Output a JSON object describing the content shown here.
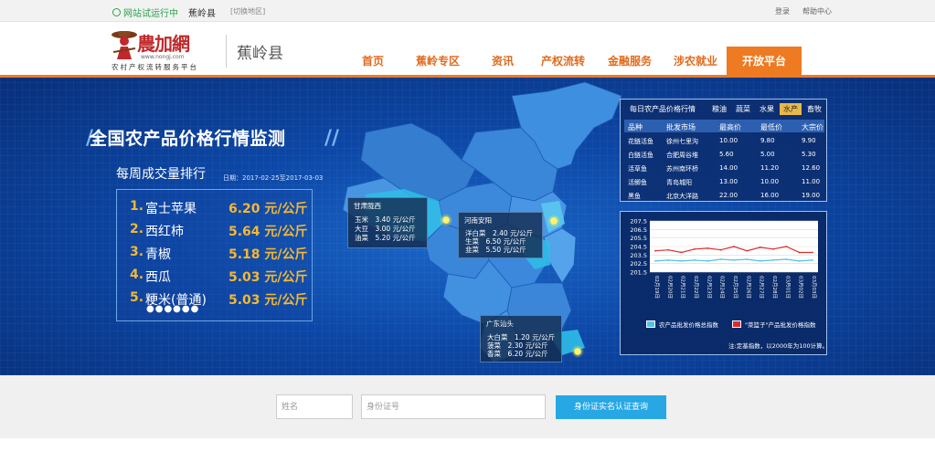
{
  "topbar": {
    "status": "网站试运行中",
    "county": "蕉岭县",
    "switch_region": "[切换地区]",
    "login": "登录",
    "help": "帮助中心"
  },
  "header": {
    "logo_brand": "農加網",
    "logo_url": "www.nongj.com",
    "logo_tagline": "农村产权流转服务平台",
    "county_title": "蕉岭县"
  },
  "nav": [
    {
      "label": "首页",
      "active": false
    },
    {
      "label": "蕉岭专区",
      "active": false
    },
    {
      "label": "资讯",
      "active": false
    },
    {
      "label": "产权流转",
      "active": false
    },
    {
      "label": "金融服务",
      "active": false
    },
    {
      "label": "涉农就业",
      "active": false
    },
    {
      "label": "开放平台",
      "active": true
    }
  ],
  "banner": {
    "headline": "全国农产品价格行情监测",
    "weekly_title": "每周成交量排行",
    "date_range": "日期：2017-02-25至2017-03-03",
    "ranking": [
      {
        "rank": "1.",
        "name": "富士苹果",
        "price": "6.20 元/公斤"
      },
      {
        "rank": "2.",
        "name": "西红柿",
        "price": "5.64 元/公斤"
      },
      {
        "rank": "3.",
        "name": "青椒",
        "price": "5.18 元/公斤"
      },
      {
        "rank": "4.",
        "name": "西瓜",
        "price": "5.03 元/公斤"
      },
      {
        "rank": "5.",
        "name": "粳米(普通)",
        "price": "5.03 元/公斤"
      }
    ],
    "ranking_pager": "●●●●●●"
  },
  "callouts": {
    "gansu": {
      "title": "甘肃陇西",
      "lines": [
        "玉米　3.40 元/公斤",
        "大豆　3.00 元/公斤",
        "油菜　5.20 元/公斤"
      ]
    },
    "henan": {
      "title": "河南安阳",
      "lines": [
        "洋白菜　2.40 元/公斤",
        "生菜　6.50 元/公斤",
        "韭菜　5.50 元/公斤"
      ]
    },
    "guangdong": {
      "title": "广东汕头",
      "lines": [
        "大白菜　1.20 元/公斤",
        "菠菜　2.30 元/公斤",
        "香菜　6.20 元/公斤"
      ]
    }
  },
  "quote_table": {
    "title": "每日农产品价格行情",
    "tabs": [
      {
        "label": "粮油",
        "active": false
      },
      {
        "label": "蔬菜",
        "active": false
      },
      {
        "label": "水果",
        "active": false
      },
      {
        "label": "水产",
        "active": true
      },
      {
        "label": "畜牧",
        "active": false
      }
    ],
    "columns": [
      "品种",
      "批发市场",
      "最高价",
      "最低价",
      "大宗价"
    ],
    "rows": [
      [
        "花鲢活鱼",
        "徐州七里沟",
        "10.00",
        "9.80",
        "9.90"
      ],
      [
        "白鲢活鱼",
        "合肥周谷堆",
        "5.60",
        "5.00",
        "5.30"
      ],
      [
        "活草鱼",
        "苏州南环桥",
        "14.00",
        "11.20",
        "12.60"
      ],
      [
        "活鲫鱼",
        "青岛城阳",
        "13.00",
        "10.00",
        "11.00"
      ],
      [
        "黑鱼",
        "北京大洋路",
        "22.00",
        "16.00",
        "19.00"
      ]
    ]
  },
  "chart_data": {
    "type": "line",
    "title": "",
    "xlabel": "",
    "ylabel": "",
    "ylim": [
      201.5,
      207.5
    ],
    "yticks": [
      "207.5",
      "206.5",
      "205.5",
      "204.5",
      "203.5",
      "202.5",
      "201.5"
    ],
    "x": [
      "02月19日",
      "02月20日",
      "02月21日",
      "02月22日",
      "02月23日",
      "02月24日",
      "02月25日",
      "02月26日",
      "02月27日",
      "02月28日",
      "03月01日",
      "03月02日",
      "03月03日"
    ],
    "series": [
      {
        "name": "农产品批发价格总指数",
        "color": "#4fc3e8",
        "values": [
          202.8,
          202.9,
          202.8,
          202.9,
          202.8,
          203.0,
          202.9,
          203.0,
          202.8,
          202.9,
          203.0,
          202.8,
          202.9
        ]
      },
      {
        "name": "\"菜篮子\"产品批发价格指数",
        "color": "#e02b2b",
        "values": [
          204.0,
          204.1,
          203.8,
          204.2,
          204.3,
          204.1,
          204.5,
          204.0,
          204.4,
          204.2,
          204.5,
          203.8,
          203.8
        ]
      }
    ],
    "note": "注:定基指数，以2000年为100计算。"
  },
  "footer": {
    "name_placeholder": "姓名",
    "id_placeholder": "身份证号",
    "submit_label": "身份证实名认证查询"
  },
  "colors": {
    "accent_orange": "#ee7a22",
    "banner_blue": "#0c47a6",
    "gold": "#f5b830",
    "submit_blue": "#27a7e4"
  }
}
